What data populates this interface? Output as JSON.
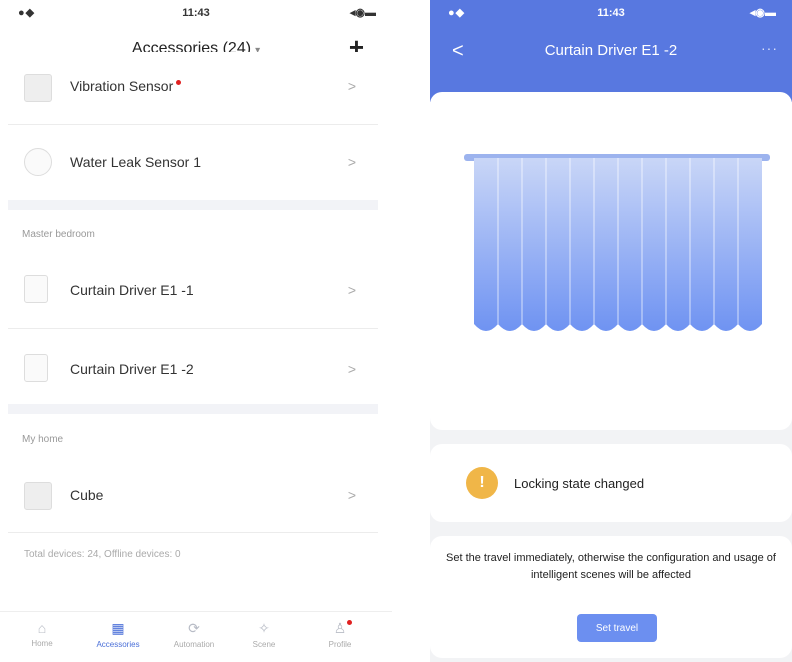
{
  "left": {
    "status": {
      "time": "11:43",
      "signal": "●◆",
      "battery": "◂◉▬"
    },
    "header": {
      "title": "Accessories (24)",
      "caret": "▾",
      "add_glyph": "+"
    },
    "sections": [
      {
        "label": "Master bedroom"
      },
      {
        "label": "My home"
      }
    ],
    "devices": [
      {
        "name": "Vibration Sensor",
        "chevron": ">"
      },
      {
        "name": "Water Leak Sensor 1",
        "chevron": ">"
      },
      {
        "name": "Curtain Driver E1 -1",
        "chevron": ">"
      },
      {
        "name": "Curtain Driver E1 -2",
        "chevron": ">"
      },
      {
        "name": "Cube",
        "chevron": ">"
      }
    ],
    "footer_note": "Total devices: 24, Offline devices: 0",
    "tabs": [
      {
        "label": "Home",
        "icon": "home-icon",
        "glyph": "⌂"
      },
      {
        "label": "Accessories",
        "icon": "accessories-icon",
        "glyph": "▦"
      },
      {
        "label": "Automation",
        "icon": "automation-icon",
        "glyph": "⟳"
      },
      {
        "label": "Scene",
        "icon": "scene-icon",
        "glyph": "✧"
      },
      {
        "label": "Profile",
        "icon": "profile-icon",
        "glyph": "♙"
      }
    ],
    "active_tab": "Accessories",
    "colors": {
      "accent": "#4a6fd8",
      "badge": "#e02020"
    }
  },
  "right": {
    "status": {
      "time": "11:43",
      "signal": "●◆",
      "battery": "◂◉▬"
    },
    "header": {
      "back": "<",
      "title": "Curtain Driver E1 -2",
      "more": "···"
    },
    "alert": {
      "text": "Locking state changed",
      "icon": "warning-icon",
      "glyph": "!"
    },
    "info": {
      "text": "Set the travel immediately, otherwise the configuration and usage of intelligent scenes will be affected",
      "button": "Set travel"
    },
    "colors": {
      "header": "#5878e0",
      "curtain_top": "#c9d6f7",
      "curtain_bottom": "#6f93f2",
      "warning": "#f0b648",
      "button": "#6c8ff0"
    }
  }
}
